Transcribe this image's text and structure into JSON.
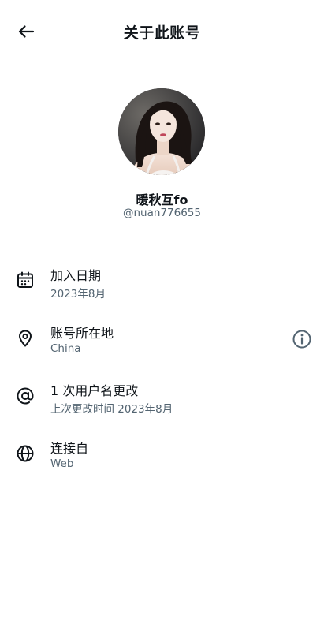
{
  "header": {
    "title": "关于此账号",
    "back_icon": "arrow-left-icon"
  },
  "profile": {
    "display_name": "暖秋互fo",
    "handle": "@nuan776655"
  },
  "items": [
    {
      "icon": "calendar-icon",
      "title": "加入日期",
      "subtitle": "2023年8月"
    },
    {
      "icon": "location-pin-icon",
      "title": "账号所在地",
      "subtitle": "China"
    },
    {
      "icon": "at-sign-icon",
      "title": "1 次用户名更改",
      "subtitle": "上次更改时间 2023年8月"
    },
    {
      "icon": "globe-icon",
      "title": "连接自",
      "subtitle": "Web"
    }
  ],
  "colors": {
    "text_primary": "#0f1419",
    "text_secondary": "#536471",
    "background": "#ffffff"
  }
}
